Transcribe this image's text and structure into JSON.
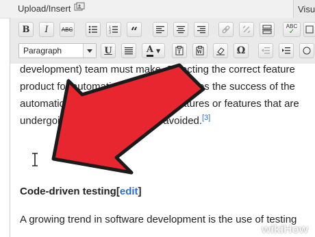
{
  "header": {
    "upload_label": "Upload/Insert",
    "visual_tab": "Visu"
  },
  "toolbar": {
    "format_select": "Paragraph",
    "row1": [
      "bold-icon",
      "italic-icon",
      "strikethrough-icon",
      "bullet-list-icon",
      "numbered-list-icon",
      "blockquote-icon",
      "align-left-icon",
      "align-center-icon",
      "align-right-icon",
      "insert-link-icon",
      "remove-link-icon",
      "insert-more-icon",
      "spellcheck-icon",
      "fullscreen-icon"
    ],
    "row2": [
      "underline-icon",
      "justify-icon",
      "text-color-icon",
      "paste-text-icon",
      "paste-word-icon",
      "clear-format-icon",
      "special-char-icon",
      "outdent-icon",
      "indent-icon"
    ]
  },
  "content": {
    "line1": "development) team must make. Selecting the correct feature",
    "line2": "product for automation largely determines the success of the",
    "line3": "automation. Automating unstable features or features that are",
    "line4": "undergoing changes should be avoided.",
    "ref": "[3]",
    "heading": "Code-driven testing",
    "bracket_open": "[",
    "edit_link": "edit",
    "bracket_close": "]",
    "line5": "A growing trend in software development is the use of testing"
  },
  "watermark": "wikiHow",
  "colors": {
    "arrow": "#e8262f",
    "link": "#2a6ec9",
    "toolbar": "#eaeaea"
  }
}
